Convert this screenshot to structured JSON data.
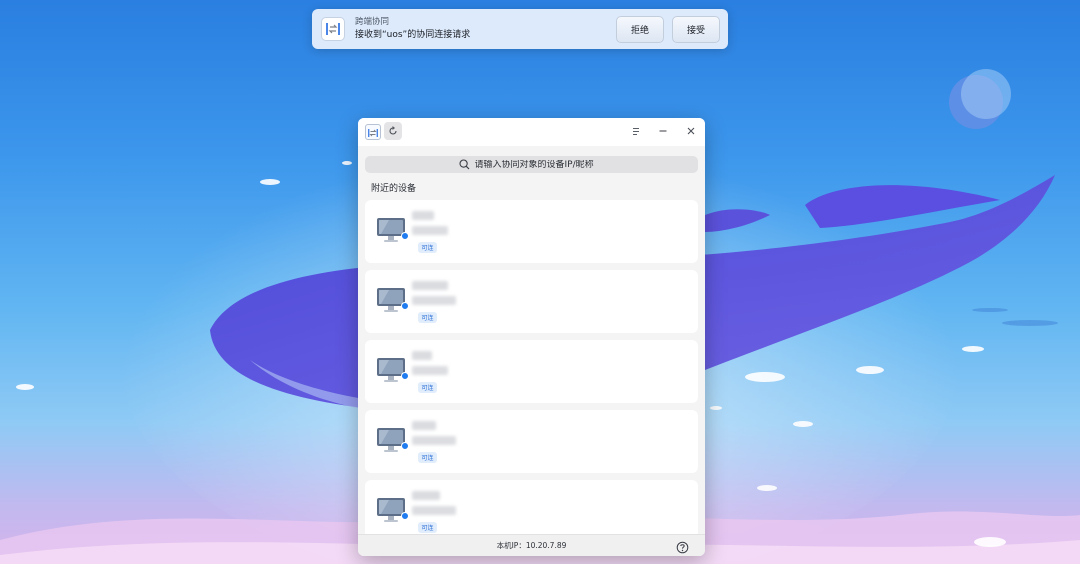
{
  "notification": {
    "app_name": "跨端协同",
    "message": "接收到“uos”的协同连接请求",
    "reject_label": "拒绝",
    "accept_label": "接受"
  },
  "window": {
    "search_placeholder": "请输入协同对象的设备IP/昵称",
    "section_title": "附近的设备",
    "devices": [
      {
        "status": "可连"
      },
      {
        "status": "可连"
      },
      {
        "status": "可连"
      },
      {
        "status": "可连"
      },
      {
        "status": "可连"
      }
    ],
    "local_ip": "本机IP：10.20.7.89"
  },
  "colors": {
    "accent": "#2a6fd7",
    "badge_bg": "#e2edfb",
    "online_dot": "#1e7cf0"
  },
  "icons": [
    "cooperation-app-icon",
    "refresh-icon",
    "menu-icon",
    "minimize-icon",
    "close-icon",
    "search-icon",
    "computer-icon",
    "help-icon"
  ]
}
